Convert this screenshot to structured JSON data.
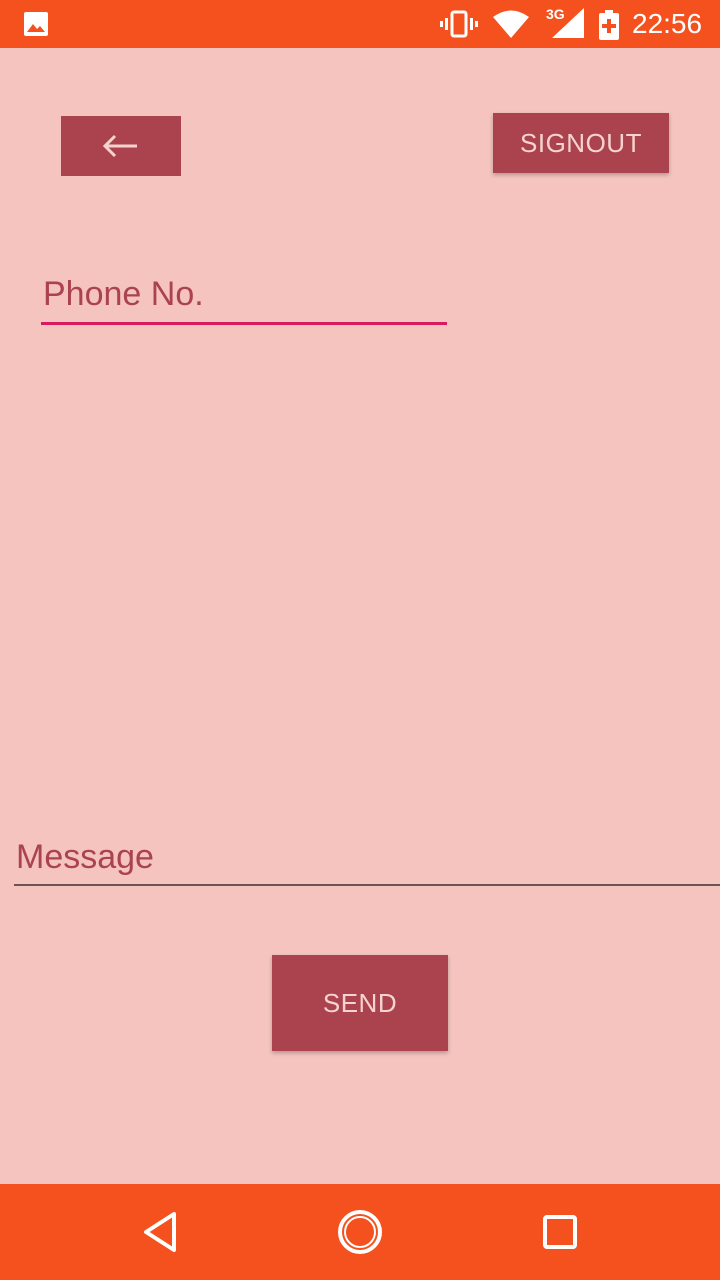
{
  "status_bar": {
    "time": "22:56",
    "network_type": "3G",
    "icons": [
      "gallery-icon",
      "vibrate-icon",
      "wifi-icon",
      "cell-signal-icon",
      "battery-charging-icon"
    ],
    "background_color": "#f4511e"
  },
  "toolbar": {
    "back_icon": "arrow-left-icon",
    "signout_label": "SIGNOUT"
  },
  "form": {
    "phone_placeholder": "Phone No.",
    "phone_value": "",
    "message_placeholder": "Message",
    "message_value": "",
    "send_label": "SEND"
  },
  "nav_bar": {
    "icons": [
      "nav-back-icon",
      "nav-home-icon",
      "nav-recent-icon"
    ]
  },
  "colors": {
    "background": "#f5c4bf",
    "button": "#ab434e",
    "button_text": "#f7d3cf",
    "accent_underline": "#d81b60"
  }
}
